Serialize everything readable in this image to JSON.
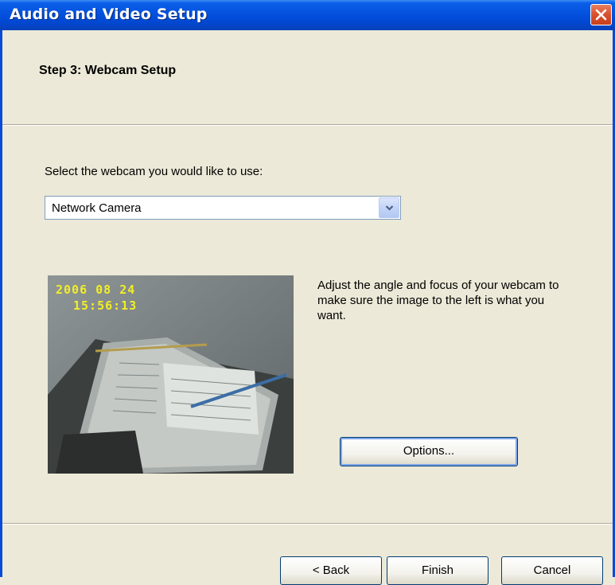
{
  "window": {
    "title": "Audio and Video Setup",
    "close_icon": "close-icon"
  },
  "header": {
    "step_title": "Step 3: Webcam Setup"
  },
  "webcam": {
    "select_label": "Select the webcam you would like to use:",
    "selected": "Network Camera",
    "help_text": "Adjust the angle and focus of your webcam to make sure the image to the left is what you want.",
    "options_label": "Options...",
    "preview": {
      "date": "2006 08 24",
      "time": "15:56:13"
    }
  },
  "footer": {
    "back_label": "< Back",
    "finish_label": "Finish",
    "cancel_label": "Cancel"
  },
  "colors": {
    "titlebar": "#0553e0",
    "window_bg": "#ece9d8",
    "close_button": "#d8502c",
    "timestamp": "#f1ee27"
  }
}
